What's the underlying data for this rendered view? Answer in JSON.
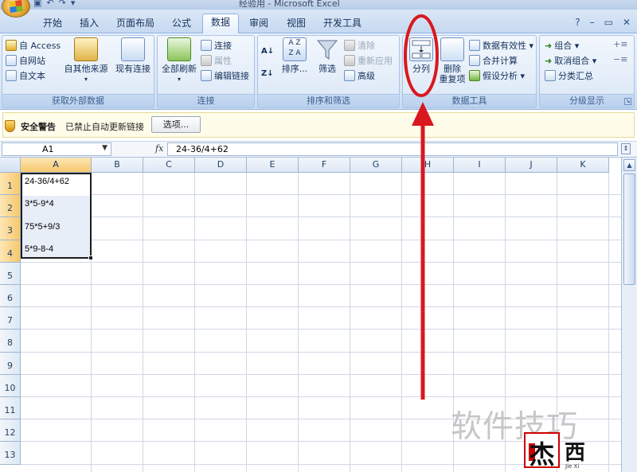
{
  "window": {
    "title": "经验用 - Microsoft Excel"
  },
  "tabs": [
    "开始",
    "插入",
    "页面布局",
    "公式",
    "数据",
    "审阅",
    "视图",
    "开发工具"
  ],
  "active_tab": "数据",
  "ribbon": {
    "groups": {
      "external": {
        "label": "获取外部数据",
        "access": "自 Access",
        "web": "自网站",
        "text": "自文本",
        "other": "自其他来源",
        "existing": "现有连接"
      },
      "connections": {
        "label": "连接",
        "refresh_all": "全部刷新",
        "connections": "连接",
        "properties": "属性",
        "edit_links": "编辑链接"
      },
      "sort_filter": {
        "label": "排序和筛选",
        "sort": "排序...",
        "filter": "筛选",
        "clear": "清除",
        "reapply": "重新应用",
        "advanced": "高级"
      },
      "data_tools": {
        "label": "数据工具",
        "text_to_columns": "分列",
        "remove_dup_1": "删除",
        "remove_dup_2": "重复项",
        "validation": "数据有效性 ▾",
        "consolidate": "合并计算",
        "whatif": "假设分析 ▾"
      },
      "outline": {
        "label": "分级显示",
        "group": "组合 ▾",
        "ungroup": "取消组合 ▾",
        "subtotal": "分类汇总"
      }
    }
  },
  "security_bar": {
    "title": "安全警告",
    "message": "已禁止自动更新链接",
    "options_button": "选项..."
  },
  "formula_bar": {
    "name_box": "A1",
    "fx": "fx",
    "formula": "24-36/4+62"
  },
  "sheet": {
    "columns": [
      "A",
      "B",
      "C",
      "D",
      "E",
      "F",
      "G",
      "H",
      "I",
      "J",
      "K"
    ],
    "rows": [
      "1",
      "2",
      "3",
      "4",
      "5",
      "6",
      "7",
      "8",
      "9",
      "10",
      "11",
      "12",
      "13"
    ],
    "cells_A": [
      "24-36/4+62",
      "3*5-9*4",
      "75*5+9/3",
      "5*9-8-4"
    ]
  },
  "watermark": {
    "text": "软件技巧",
    "logo_char": "杰",
    "logo_char2": "西",
    "logo_sub": "Jie Xi"
  },
  "colors": {
    "annotation_red": "#d9181f",
    "ribbon_blue": "#dbe7f6",
    "selection_fill": "#e8eef8"
  },
  "icons": [
    "office-button-icon",
    "shield-icon",
    "fx-icon",
    "chevron-down-icon",
    "scroll-up-icon"
  ]
}
